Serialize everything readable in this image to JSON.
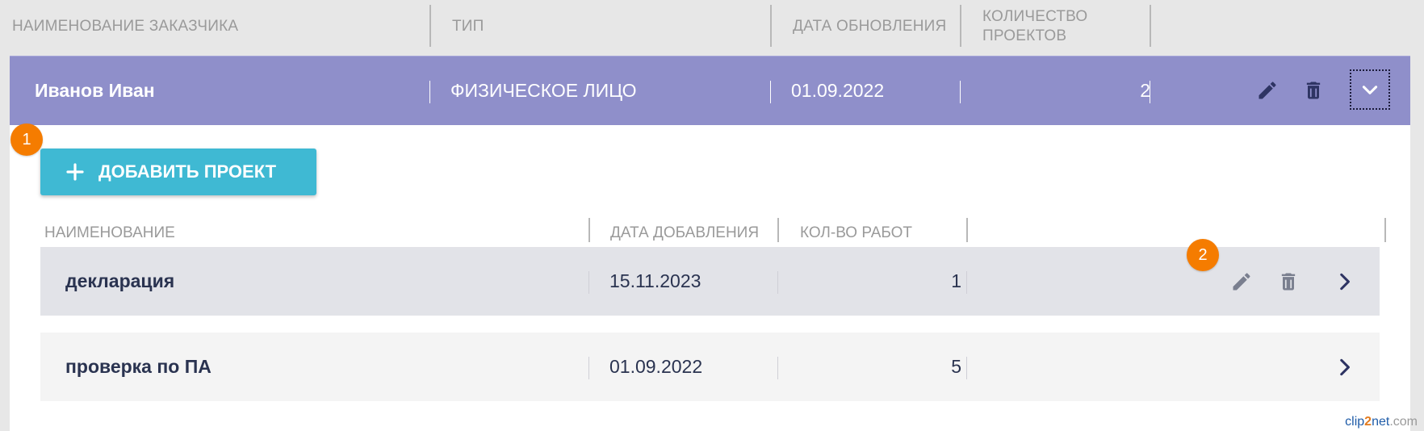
{
  "main_header": {
    "col_name": "НАИМЕНОВАНИЕ ЗАКАЗЧИКА",
    "col_type": "ТИП",
    "col_updated": "ДАТА ОБНОВЛЕНИЯ",
    "col_count_line1": "КОЛИЧЕСТВО",
    "col_count_line2": "ПРОЕКТОВ"
  },
  "client": {
    "name": "Иванов Иван",
    "type": "ФИЗИЧЕСКОЕ ЛИЦО",
    "updated": "01.09.2022",
    "projects_count": "2",
    "row_color": "#8f8fca",
    "icons": [
      "edit-icon",
      "trash-icon",
      "chevron-down-icon"
    ]
  },
  "badges": {
    "first": "1",
    "second": "2"
  },
  "add_button": {
    "label": "ДОБАВИТЬ ПРОЕКТ",
    "color": "#3fb9d3"
  },
  "projects_header": {
    "col_name": "НАИМЕНОВАНИЕ",
    "col_added": "ДАТА ДОБАВЛЕНИЯ",
    "col_works": "КОЛ-ВО РАБОТ"
  },
  "projects": [
    {
      "name": "декларация",
      "added": "15.11.2023",
      "works": "1",
      "row_color": "#e2e3e8"
    },
    {
      "name": "проверка по ПА",
      "added": "01.09.2022",
      "works": "5",
      "row_color": "#f4f4f4"
    }
  ],
  "watermark": {
    "part1": "clip",
    "part2": "2",
    "part3": "net",
    "part4": ".com"
  }
}
